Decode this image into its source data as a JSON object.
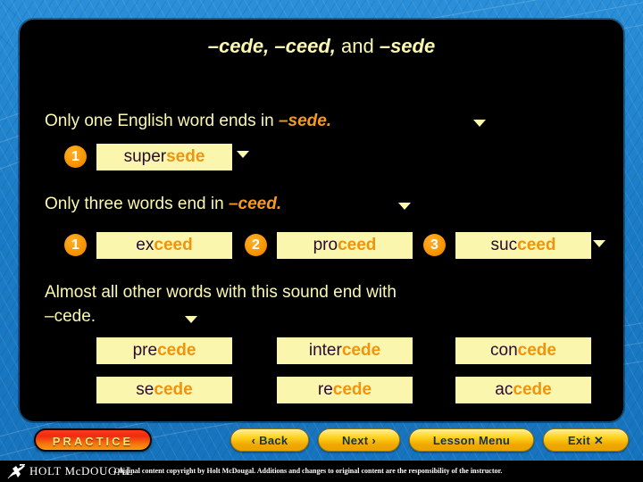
{
  "slide": {
    "title_parts": [
      {
        "text": "–cede,",
        "style": "suffix"
      },
      {
        "text": " ",
        "style": "plain"
      },
      {
        "text": "–ceed,",
        "style": "suffix"
      },
      {
        "text": " and ",
        "style": "plain"
      },
      {
        "text": "–sede",
        "style": "suffix"
      }
    ],
    "title_text": "–cede, –ceed, and –sede"
  },
  "content": {
    "line1_lead": "Only one English word ends in ",
    "line1_suffix": "–sede.",
    "line2_lead": "Only three words end in ",
    "line2_suffix": "–ceed.",
    "line3_lead": "Almost all other words with this sound end with",
    "line3_suffix": "–cede.",
    "sede_words": [
      {
        "number": "1",
        "prefix": "super",
        "root": "sede"
      }
    ],
    "ceed_words": [
      {
        "number": "1",
        "prefix": "ex",
        "root": "ceed"
      },
      {
        "number": "2",
        "prefix": "pro",
        "root": "ceed"
      },
      {
        "number": "3",
        "prefix": "suc",
        "root": "ceed"
      }
    ],
    "cede_words_row1": [
      {
        "prefix": "pre",
        "root": "cede"
      },
      {
        "prefix": "inter",
        "root": "cede"
      },
      {
        "prefix": "con",
        "root": "cede"
      }
    ],
    "cede_words_row2": [
      {
        "prefix": "se",
        "root": "cede"
      },
      {
        "prefix": "re",
        "root": "cede"
      },
      {
        "prefix": "ac",
        "root": "cede"
      }
    ]
  },
  "buttons": {
    "practice": "PRACTICE",
    "back": "Back",
    "back_icon": "chevron-left-icon",
    "next": "Next",
    "next_icon": "chevron-right-icon",
    "lesson_menu": "Lesson Menu",
    "exit": "Exit",
    "exit_icon": "close-x-icon",
    "back_chevron": "‹",
    "next_chevron": "›",
    "exit_x": "✕"
  },
  "footer": {
    "logo_icon": "holt-mcdougal-runner-icon",
    "logo_text": "HOLT McDOUGAL",
    "copyright": "Original content copyright by Holt McDougal.  Additions and changes to original content are the responsibility of the instructor."
  },
  "colors": {
    "background_blue": "#1f86d0",
    "panel_black": "#000000",
    "text_pale_yellow": "#fbf8b0",
    "accent_orange": "#f59a1e",
    "word_box_bg": "#fbf6ad",
    "word_prefix_dark": "#2a0a2e",
    "word_root_orange": "#f0930d",
    "nav_button_yellow": "#ffd21b",
    "practice_red": "#ef2b10"
  }
}
